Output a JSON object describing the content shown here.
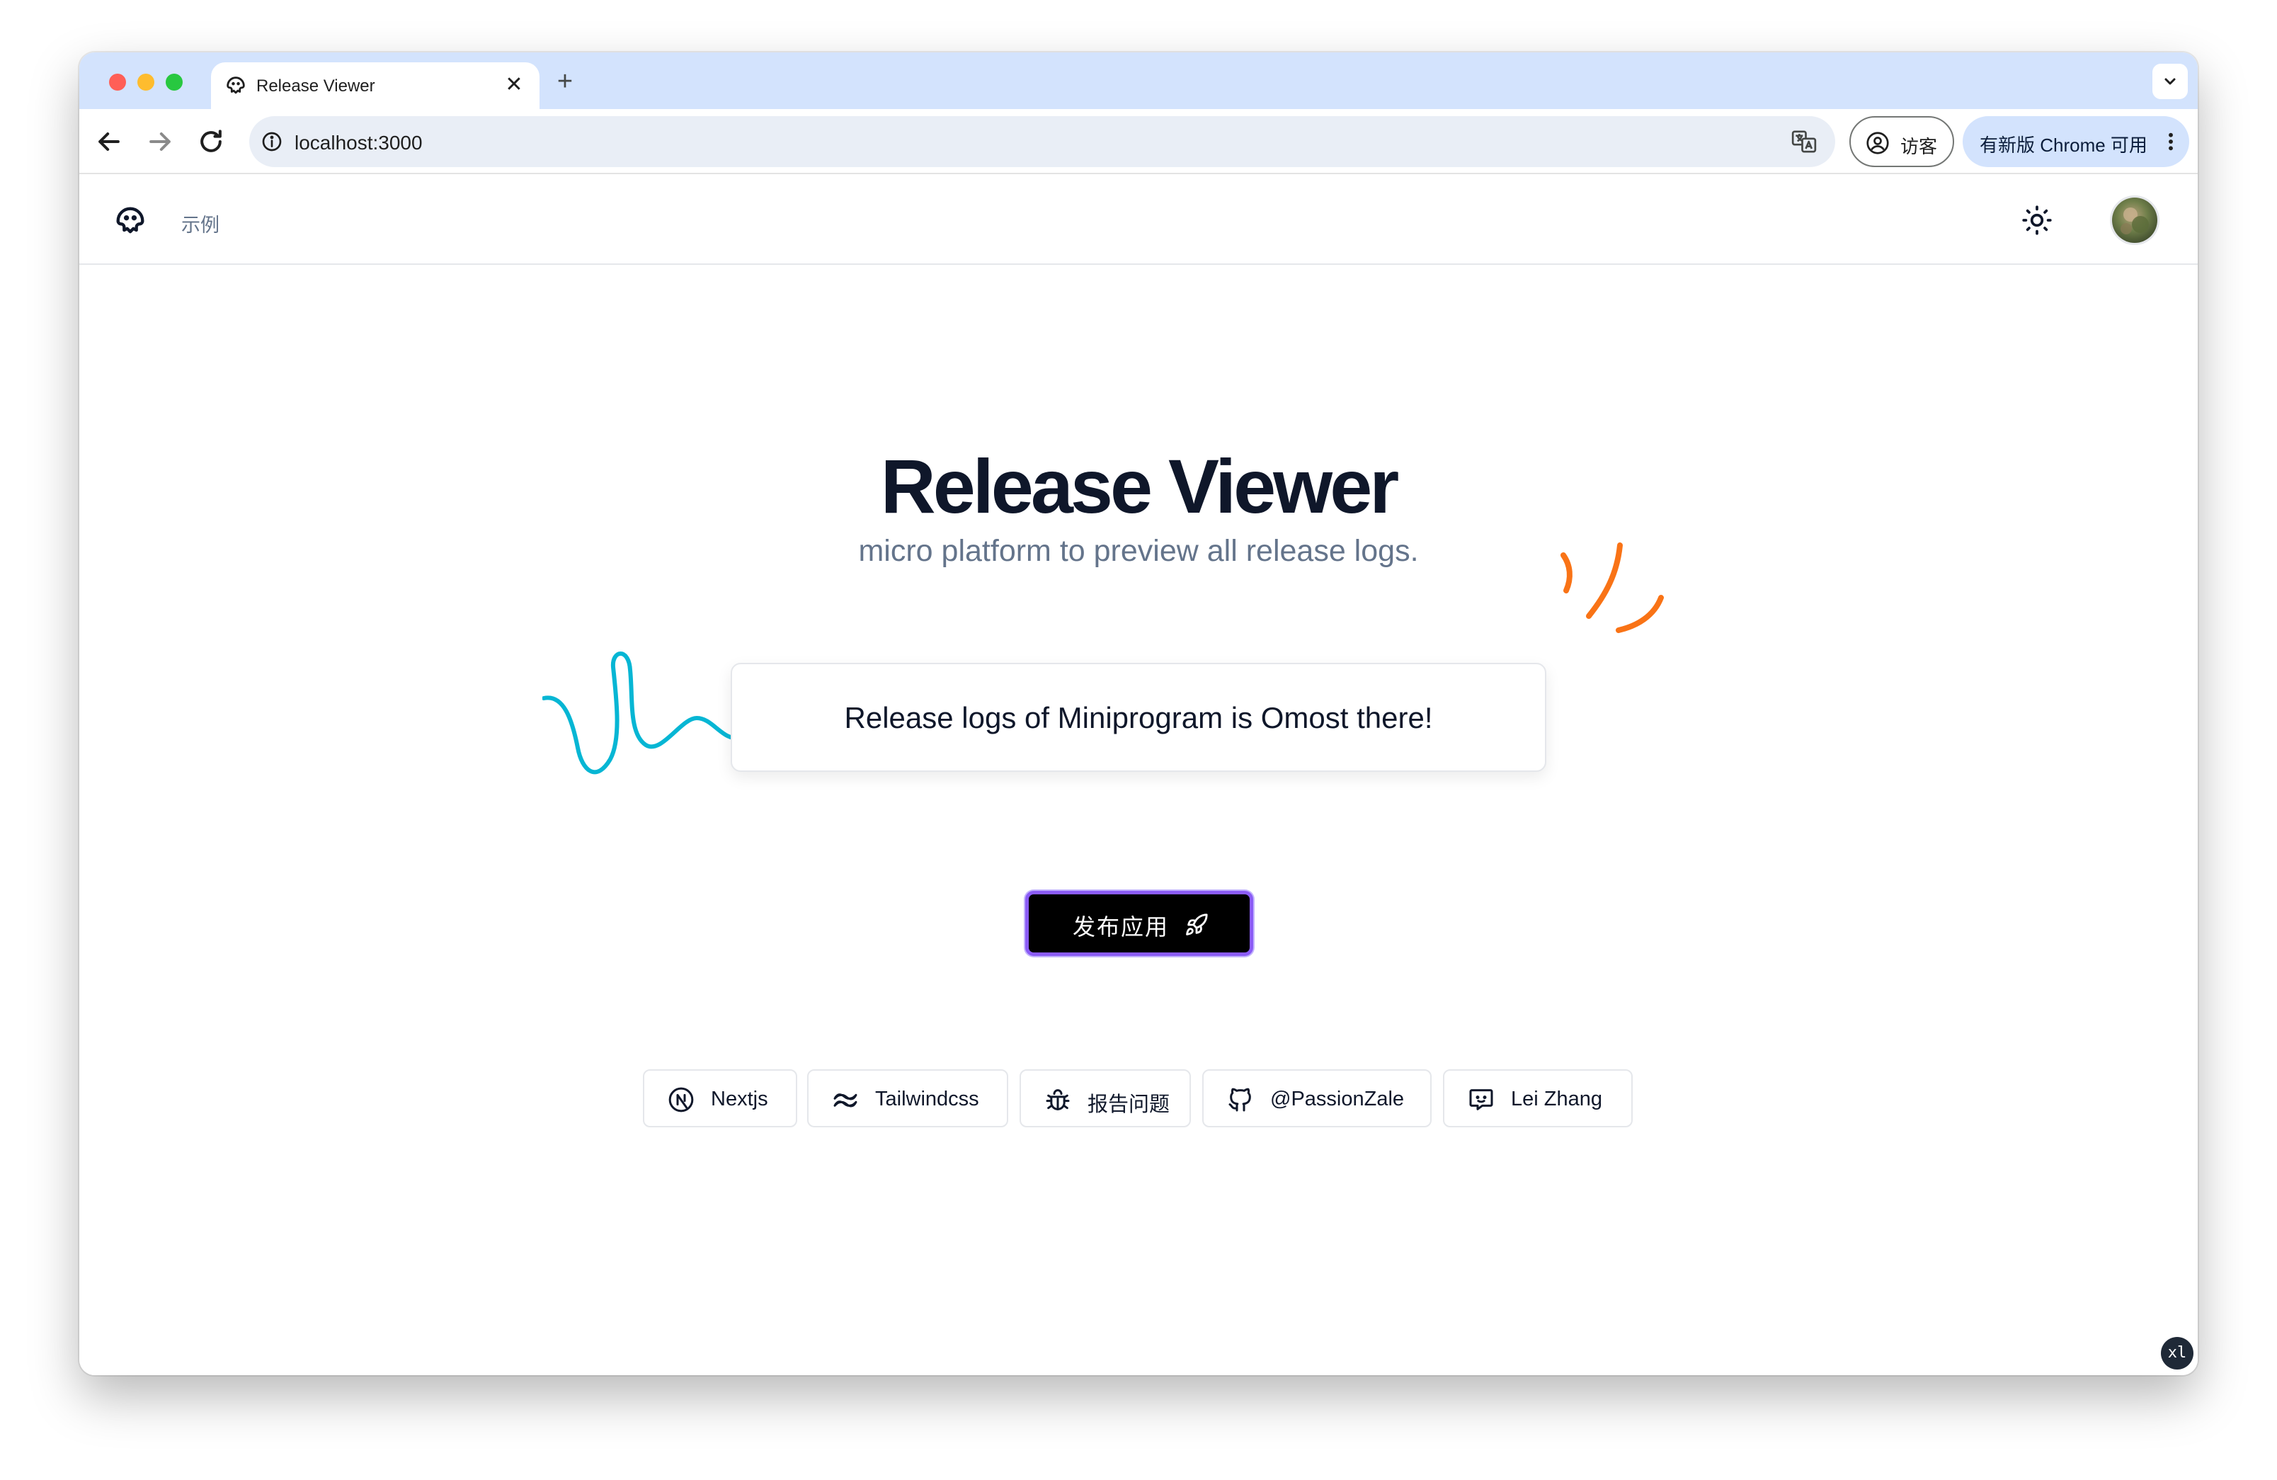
{
  "browser": {
    "tab_title": "Release Viewer",
    "tab_close_glyph": "✕",
    "new_tab_glyph": "+",
    "url": "localhost:3000",
    "guest_label": "访客",
    "update_label": "有新版 Chrome 可用"
  },
  "header": {
    "nav_example": "示例"
  },
  "hero": {
    "title": "Release Viewer",
    "subtitle": "micro platform to preview all release logs."
  },
  "message": {
    "text": "Release logs of  Miniprogram  is Omost there!"
  },
  "publish": {
    "label": "发布应用"
  },
  "links": [
    {
      "label": "Nextjs",
      "icon": "nextjs-icon"
    },
    {
      "label": "Tailwindcss",
      "icon": "tailwind-icon"
    },
    {
      "label": "报告问题",
      "icon": "bug-icon"
    },
    {
      "label": "@PassionZale",
      "icon": "github-icon"
    },
    {
      "label": "Lei Zhang",
      "icon": "chat-icon"
    }
  ],
  "badge": {
    "text": "xl"
  },
  "colors": {
    "tab_strip": "#d3e3fd",
    "publish_border": "#8b5cf6",
    "squiggle_orange": "#f97316",
    "squiggle_blue": "#06b6d4",
    "subtitle": "#64748b"
  }
}
